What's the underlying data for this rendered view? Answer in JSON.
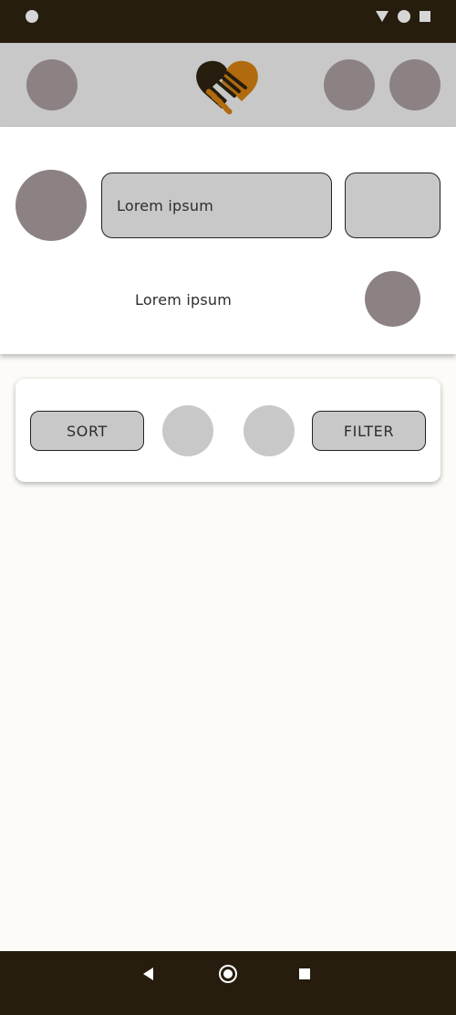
{
  "status_bar": {
    "icons": [
      "notification-dot-icon",
      "wifi-icon",
      "signal-icon",
      "battery-icon"
    ],
    "background_color": "#261d0e"
  },
  "app_bar": {
    "logo_icon": "handshake-heart-logo",
    "background_color": "#c8c8c8",
    "placeholder_color": "#8c8284"
  },
  "search": {
    "input_text": "Lorem ipsum",
    "label": "Lorem ipsum"
  },
  "controls": {
    "sort_label": "SORT",
    "filter_label": "FILTER"
  },
  "navigation": {
    "icons": [
      "back-icon",
      "home-icon",
      "recents-icon"
    ],
    "background_color": "#261d0e"
  },
  "colors": {
    "brand_dark": "#261d0e",
    "brand_orange": "#b06b0e",
    "surface": "#fcfbf8"
  }
}
